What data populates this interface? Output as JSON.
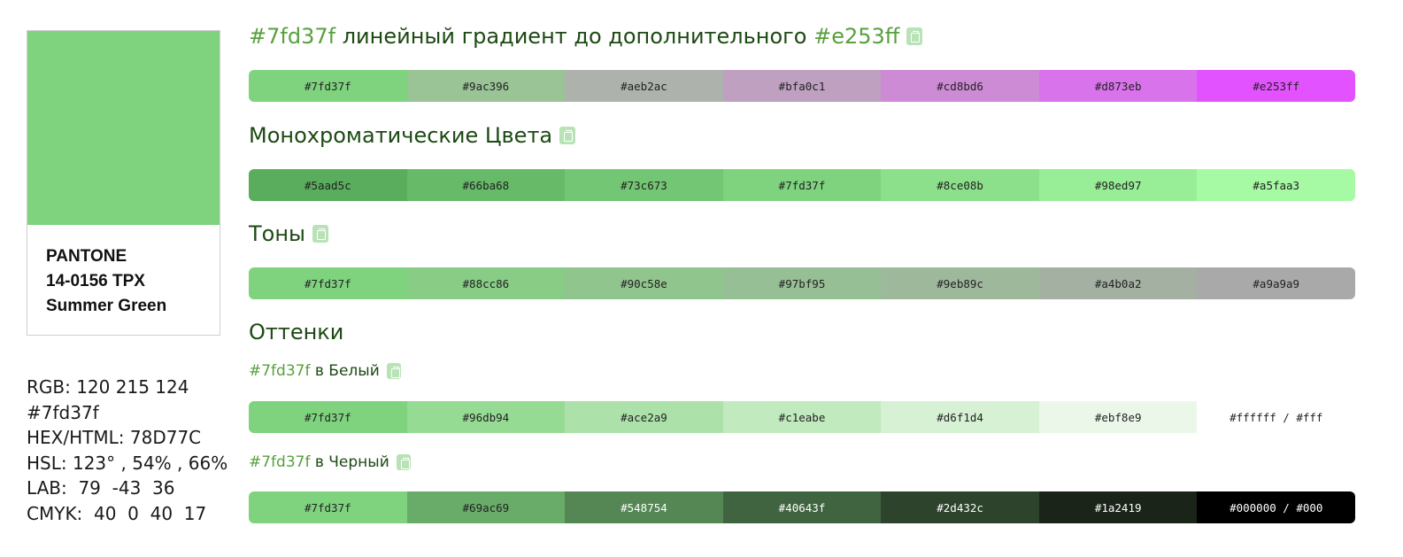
{
  "swatch": {
    "color": "#7fd37f",
    "pantone_line1": "PANTONE",
    "pantone_line2": "14-0156 TPX",
    "pantone_line3": "Summer Green"
  },
  "info": {
    "rgb": "RGB: 120 215 124",
    "hex_short": "#7fd37f",
    "hex_html": "HEX/HTML: 78D77C",
    "hsl": "HSL: 123° , 54% , 66%",
    "lab": "LAB:  79  -43  36",
    "cmyk": "CMYK:  40  0  40  17"
  },
  "gradient": {
    "hex_from": "#7fd37f",
    "title": "линейный градиент до дополнительного",
    "hex_to": "#e253ff",
    "cells": [
      {
        "label": "#7fd37f",
        "color": "#7fd37f"
      },
      {
        "label": "#9ac396",
        "color": "#9ac396"
      },
      {
        "label": "#aeb2ac",
        "color": "#aeb2ac"
      },
      {
        "label": "#bfa0c1",
        "color": "#bfa0c1"
      },
      {
        "label": "#cd8bd6",
        "color": "#cd8bd6"
      },
      {
        "label": "#d873eb",
        "color": "#d873eb"
      },
      {
        "label": "#e253ff",
        "color": "#e253ff"
      }
    ]
  },
  "monochrome": {
    "title": "Монохроматические Цвета",
    "cells": [
      {
        "label": "#5aad5c",
        "color": "#5aad5c"
      },
      {
        "label": "#66ba68",
        "color": "#66ba68"
      },
      {
        "label": "#73c673",
        "color": "#73c673"
      },
      {
        "label": "#7fd37f",
        "color": "#7fd37f"
      },
      {
        "label": "#8ce08b",
        "color": "#8ce08b"
      },
      {
        "label": "#98ed97",
        "color": "#98ed97"
      },
      {
        "label": "#a5faa3",
        "color": "#a5faa3"
      }
    ]
  },
  "tones": {
    "title": "Тоны",
    "cells": [
      {
        "label": "#7fd37f",
        "color": "#7fd37f"
      },
      {
        "label": "#88cc86",
        "color": "#88cc86"
      },
      {
        "label": "#90c58e",
        "color": "#90c58e"
      },
      {
        "label": "#97bf95",
        "color": "#97bf95"
      },
      {
        "label": "#9eb89c",
        "color": "#9eb89c"
      },
      {
        "label": "#a4b0a2",
        "color": "#a4b0a2"
      },
      {
        "label": "#a9a9a9",
        "color": "#a9a9a9"
      }
    ]
  },
  "shades": {
    "title": "Оттенки"
  },
  "to_white": {
    "hex": "#7fd37f",
    "title": "в Белый",
    "cells": [
      {
        "label": "#7fd37f",
        "color": "#7fd37f"
      },
      {
        "label": "#96db94",
        "color": "#96db94"
      },
      {
        "label": "#ace2a9",
        "color": "#ace2a9"
      },
      {
        "label": "#c1eabe",
        "color": "#c1eabe"
      },
      {
        "label": "#d6f1d4",
        "color": "#d6f1d4"
      },
      {
        "label": "#ebf8e9",
        "color": "#ebf8e9"
      },
      {
        "label": "#ffffff / #fff",
        "color": "#ffffff"
      }
    ]
  },
  "to_black": {
    "hex": "#7fd37f",
    "title": "в Черный",
    "cells": [
      {
        "label": "#7fd37f",
        "color": "#7fd37f",
        "dark": false
      },
      {
        "label": "#69ac69",
        "color": "#69ac69",
        "dark": false
      },
      {
        "label": "#548754",
        "color": "#548754",
        "dark": true
      },
      {
        "label": "#40643f",
        "color": "#40643f",
        "dark": true
      },
      {
        "label": "#2d432c",
        "color": "#2d432c",
        "dark": true
      },
      {
        "label": "#1a2419",
        "color": "#1a2419",
        "dark": true
      },
      {
        "label": "#000000 / #000",
        "color": "#000000",
        "dark": true
      }
    ]
  }
}
